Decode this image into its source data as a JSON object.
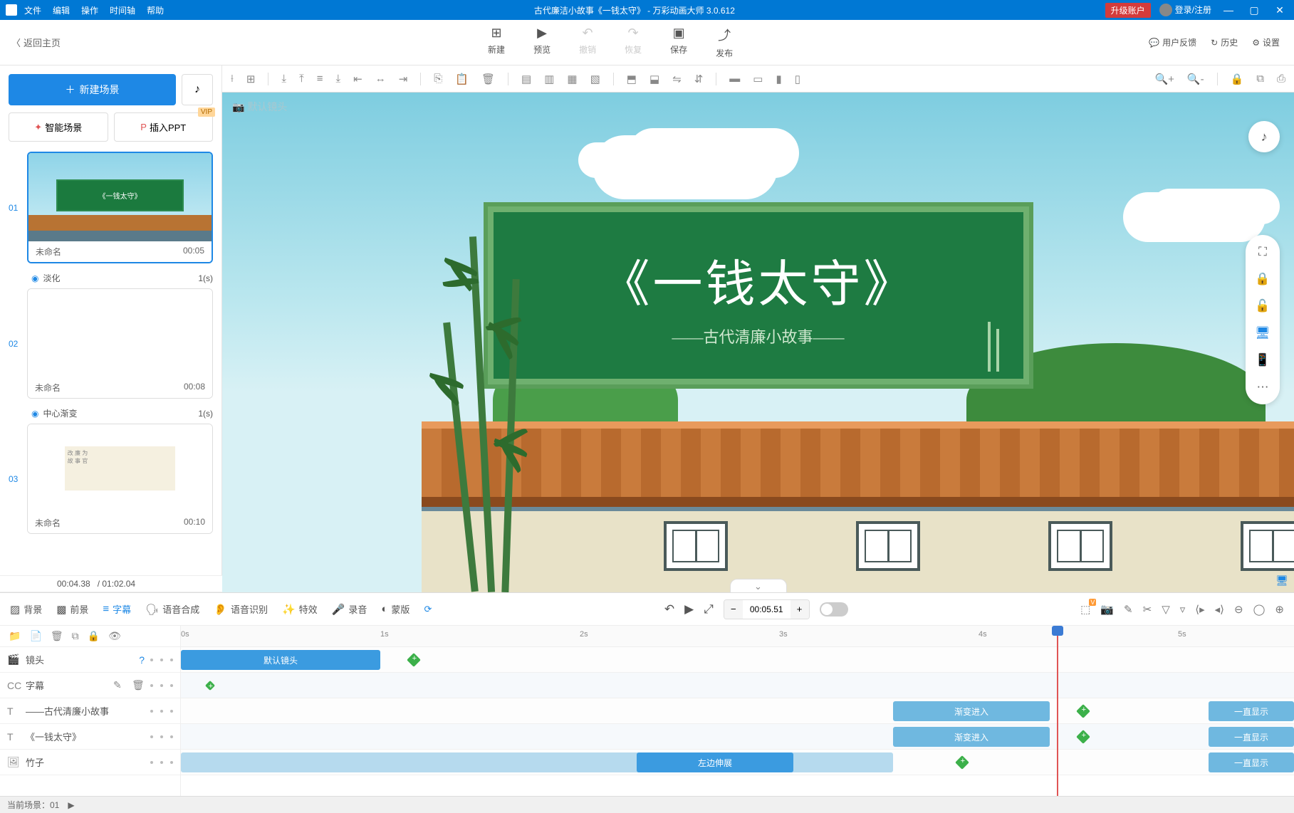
{
  "titlebar": {
    "menus": [
      "文件",
      "编辑",
      "操作",
      "时间轴",
      "帮助"
    ],
    "doc_title": "古代廉洁小故事《一钱太守》",
    "app_name": "万彩动画大师 3.0.612",
    "upgrade": "升级账户",
    "login": "登录/注册"
  },
  "maintb": {
    "back": "返回主页",
    "items": {
      "new": "新建",
      "preview": "预览",
      "undo": "撤销",
      "redo": "恢复",
      "save": "保存",
      "publish": "发布"
    },
    "right": {
      "feedback": "用户反馈",
      "history": "历史",
      "settings": "设置"
    }
  },
  "sidebar": {
    "new_scene": "新建场景",
    "ai_scene": "智能场景",
    "insert_ppt": "插入PPT",
    "vip": "VIP",
    "scenes": [
      {
        "num": "01",
        "name": "未命名",
        "dur": "00:05",
        "active": true,
        "type": "title"
      },
      {
        "num": "02",
        "name": "未命名",
        "dur": "00:08",
        "active": false,
        "type": "blank"
      },
      {
        "num": "03",
        "name": "未命名",
        "dur": "00:10",
        "active": false,
        "type": "text"
      }
    ],
    "transitions": [
      {
        "name": "淡化",
        "dur": "1(s)"
      },
      {
        "name": "中心渐变",
        "dur": "1(s)"
      }
    ],
    "time_current": "00:04.38",
    "time_total": "/ 01:02.04"
  },
  "canvas": {
    "cam_label": "默认镜头",
    "sign_title": "《一钱太守》",
    "sign_sub": "——古代清廉小故事——"
  },
  "bottom": {
    "tabs": {
      "bg": "背景",
      "fg": "前景",
      "subtitle": "字幕",
      "tts": "语音合成",
      "asr": "语音识别",
      "fx": "特效",
      "rec": "录音",
      "mask": "蒙版"
    },
    "time_display": "00:05.51",
    "tracks": {
      "camera": "镜头",
      "subtitle": "字幕",
      "t1": "——古代清廉小故事",
      "t2": "《一钱太守》",
      "t3": "竹子"
    },
    "clips": {
      "default_cam": "默认镜头",
      "fade_in": "渐变进入",
      "stretch_left": "左边伸展",
      "always_show": "一直显示"
    },
    "ruler": [
      "0s",
      "1s",
      "2s",
      "3s",
      "4s",
      "5s"
    ]
  },
  "status": {
    "current_scene": "当前场景：01"
  }
}
